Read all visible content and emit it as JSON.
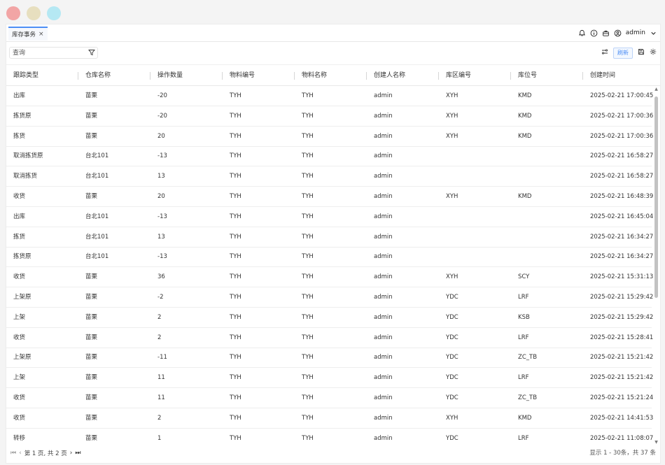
{
  "window": {
    "tab_label": "库存事务",
    "tab_close": "×",
    "user": "admin"
  },
  "toolbar": {
    "search_placeholder": "查询",
    "refresh_label": "刷新"
  },
  "table": {
    "columns": [
      "跟踪类型",
      "仓库名称",
      "操作数量",
      "物料编号",
      "物料名称",
      "创建人名称",
      "库区编号",
      "库位号",
      "创建时间"
    ],
    "rows": [
      [
        "出库",
        "苗栗",
        "-20",
        "TYH",
        "TYH",
        "admin",
        "XYH",
        "KMD",
        "2025-02-21 17:00:45"
      ],
      [
        "拣货原",
        "苗栗",
        "-20",
        "TYH",
        "TYH",
        "admin",
        "XYH",
        "KMD",
        "2025-02-21 17:00:36"
      ],
      [
        "拣货",
        "苗栗",
        "20",
        "TYH",
        "TYH",
        "admin",
        "XYH",
        "KMD",
        "2025-02-21 17:00:36"
      ],
      [
        "取消拣货原",
        "台北101",
        "-13",
        "TYH",
        "TYH",
        "admin",
        "",
        "",
        "2025-02-21 16:58:27"
      ],
      [
        "取消拣货",
        "台北101",
        "13",
        "TYH",
        "TYH",
        "admin",
        "",
        "",
        "2025-02-21 16:58:27"
      ],
      [
        "收货",
        "苗栗",
        "20",
        "TYH",
        "TYH",
        "admin",
        "XYH",
        "KMD",
        "2025-02-21 16:48:39"
      ],
      [
        "出库",
        "台北101",
        "-13",
        "TYH",
        "TYH",
        "admin",
        "",
        "",
        "2025-02-21 16:45:04"
      ],
      [
        "拣货",
        "台北101",
        "13",
        "TYH",
        "TYH",
        "admin",
        "",
        "",
        "2025-02-21 16:34:27"
      ],
      [
        "拣货原",
        "台北101",
        "-13",
        "TYH",
        "TYH",
        "admin",
        "",
        "",
        "2025-02-21 16:34:27"
      ],
      [
        "收货",
        "苗栗",
        "36",
        "TYH",
        "TYH",
        "admin",
        "XYH",
        "SCY",
        "2025-02-21 15:31:13"
      ],
      [
        "上架原",
        "苗栗",
        "-2",
        "TYH",
        "TYH",
        "admin",
        "YDC",
        "LRF",
        "2025-02-21 15:29:42"
      ],
      [
        "上架",
        "苗栗",
        "2",
        "TYH",
        "TYH",
        "admin",
        "YDC",
        "KSB",
        "2025-02-21 15:29:42"
      ],
      [
        "收货",
        "苗栗",
        "2",
        "TYH",
        "TYH",
        "admin",
        "YDC",
        "LRF",
        "2025-02-21 15:28:41"
      ],
      [
        "上架原",
        "苗栗",
        "-11",
        "TYH",
        "TYH",
        "admin",
        "YDC",
        "ZC_TB",
        "2025-02-21 15:21:42"
      ],
      [
        "上架",
        "苗栗",
        "11",
        "TYH",
        "TYH",
        "admin",
        "YDC",
        "LRF",
        "2025-02-21 15:21:42"
      ],
      [
        "收货",
        "苗栗",
        "11",
        "TYH",
        "TYH",
        "admin",
        "YDC",
        "ZC_TB",
        "2025-02-21 15:21:24"
      ],
      [
        "收货",
        "苗栗",
        "2",
        "TYH",
        "TYH",
        "admin",
        "XYH",
        "KMD",
        "2025-02-21 14:41:53"
      ],
      [
        "转移",
        "苗栗",
        "1",
        "TYH",
        "TYH",
        "admin",
        "YDC",
        "LRF",
        "2025-02-21 11:08:07"
      ]
    ]
  },
  "pagination": {
    "page_text": "第 1 页, 共 2 页",
    "summary_text": "显示 1 - 30条，共 37 条"
  },
  "colors": {
    "accent": "#4d8ef5",
    "traffic_red": "#f2a5a5",
    "traffic_yellow": "#e7dfbf",
    "traffic_cyan": "#b5e8f3"
  }
}
